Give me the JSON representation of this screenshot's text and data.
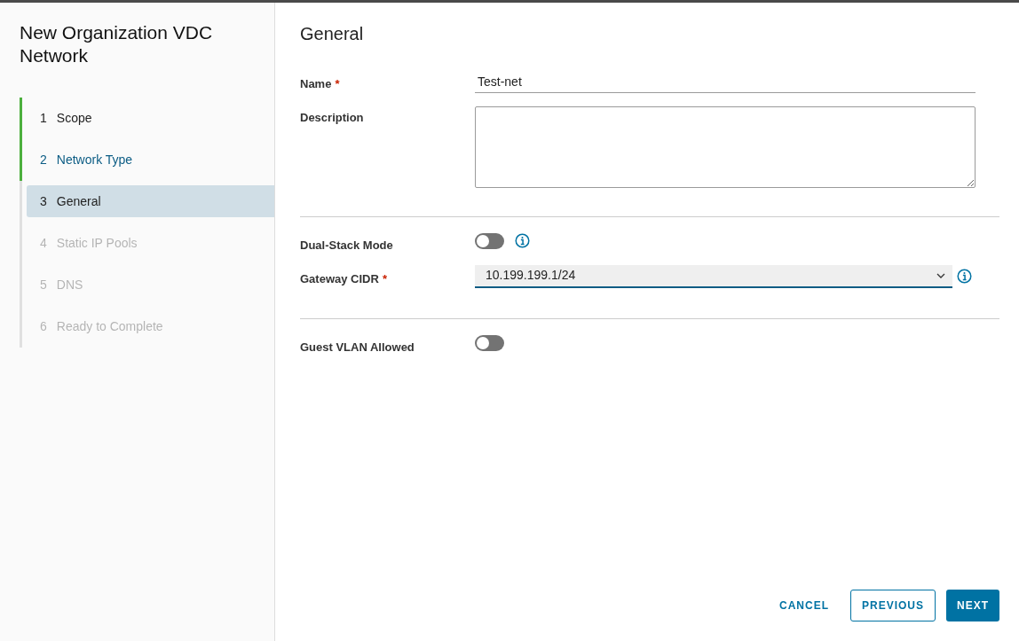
{
  "wizard": {
    "title": "New Organization VDC Network",
    "steps": [
      {
        "number": "1",
        "label": "Scope",
        "completed": true,
        "disabled": false,
        "selected": false,
        "highlighted": false
      },
      {
        "number": "2",
        "label": "Network Type",
        "completed": true,
        "disabled": false,
        "selected": false,
        "highlighted": true
      },
      {
        "number": "3",
        "label": "General",
        "completed": false,
        "disabled": false,
        "selected": true,
        "highlighted": false
      },
      {
        "number": "4",
        "label": "Static IP Pools",
        "completed": false,
        "disabled": true,
        "selected": false,
        "highlighted": false
      },
      {
        "number": "5",
        "label": "DNS",
        "completed": false,
        "disabled": true,
        "selected": false,
        "highlighted": false
      },
      {
        "number": "6",
        "label": "Ready to Complete",
        "completed": false,
        "disabled": true,
        "selected": false,
        "highlighted": false
      }
    ]
  },
  "page": {
    "title": "General",
    "fields": [
      {
        "kind": "text",
        "label": "Name",
        "required_mark": "*",
        "value": "Test-net"
      },
      {
        "kind": "textarea",
        "label": "Description"
      },
      {
        "kind": "divider"
      },
      {
        "kind": "toggle",
        "label": "Dual-Stack Mode",
        "on": false,
        "info": true
      },
      {
        "kind": "select",
        "label": "Gateway CIDR",
        "required_mark": "*",
        "value": "10.199.199.1/24",
        "info": true
      },
      {
        "kind": "divider"
      },
      {
        "kind": "toggle",
        "label": "Guest VLAN Allowed",
        "on": false,
        "info": false
      }
    ]
  },
  "buttons": [
    {
      "label": "CANCEL",
      "kind": "flat"
    },
    {
      "label": "PREVIOUS",
      "kind": "outline"
    },
    {
      "label": "NEXT",
      "kind": "primary"
    }
  ]
}
